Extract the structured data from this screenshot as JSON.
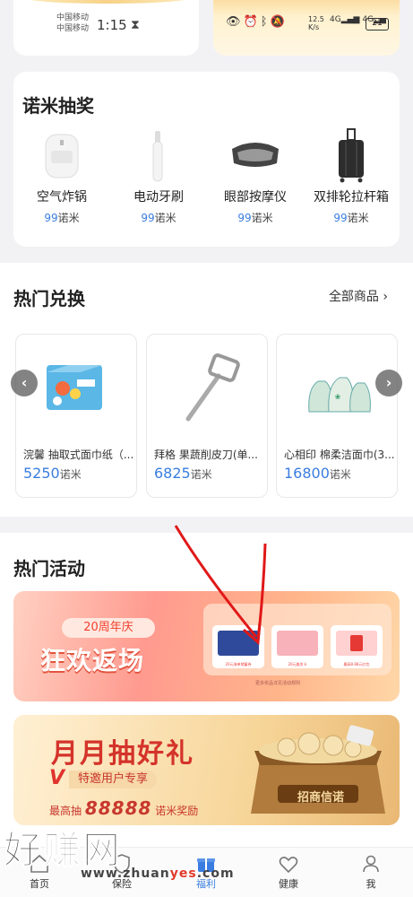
{
  "status_bar": {
    "carrier1": "中国移动",
    "carrier2": "中国移动",
    "time": "1:15",
    "speed_value": "12.5",
    "speed_unit": "K/s",
    "signal": "4G",
    "battery": "21"
  },
  "lottery": {
    "title": "诺米抽奖",
    "items": [
      {
        "name": "空气炸锅",
        "price": "99",
        "unit": "诺米",
        "icon": "air-fryer-icon"
      },
      {
        "name": "电动牙刷",
        "price": "99",
        "unit": "诺米",
        "icon": "toothbrush-icon"
      },
      {
        "name": "眼部按摩仪",
        "price": "99",
        "unit": "诺米",
        "icon": "eye-massager-icon"
      },
      {
        "name": "双排轮拉杆箱",
        "price": "99",
        "unit": "诺米",
        "icon": "suitcase-icon"
      }
    ]
  },
  "exchange": {
    "title": "热门兑换",
    "all_goods": "全部商品",
    "items": [
      {
        "name": "浣馨 抽取式面巾纸（...",
        "price": "5250",
        "unit": "诺米"
      },
      {
        "name": "拜格 果蔬削皮刀(单...",
        "price": "6825",
        "unit": "诺米"
      },
      {
        "name": "心相印 棉柔洁面巾(3...",
        "price": "16800",
        "unit": "诺米"
      }
    ]
  },
  "activities": {
    "title": "热门活动",
    "banner1": {
      "tag": "20周年庆",
      "title": "狂欢返场",
      "coupons": [
        "20元海单储蓄券",
        "20元美发卡",
        "最高8.88元红包"
      ],
      "note": "更多奖品详见活动规则"
    },
    "banner2": {
      "title": "月月抽好礼",
      "v": "V",
      "subtitle": "特邀用户专享",
      "bottom_prefix": "最高抽",
      "bottom_number": "88888",
      "bottom_suffix": "诺米奖励",
      "chest_label": "招商信诺"
    }
  },
  "bottom_nav": [
    {
      "label": "首页",
      "icon": "home-icon"
    },
    {
      "label": "保险",
      "icon": "shield-icon"
    },
    {
      "label": "福利",
      "icon": "gift-icon"
    },
    {
      "label": "健康",
      "icon": "heart-icon"
    },
    {
      "label": "我",
      "icon": "user-icon"
    }
  ],
  "watermark": {
    "text": "好赚网",
    "url_prefix": "www.zhuan",
    "url_highlight": "yes",
    "url_suffix": ".com"
  },
  "colors": {
    "accent_blue": "#3a7de0",
    "banner_red": "#d4332a"
  }
}
